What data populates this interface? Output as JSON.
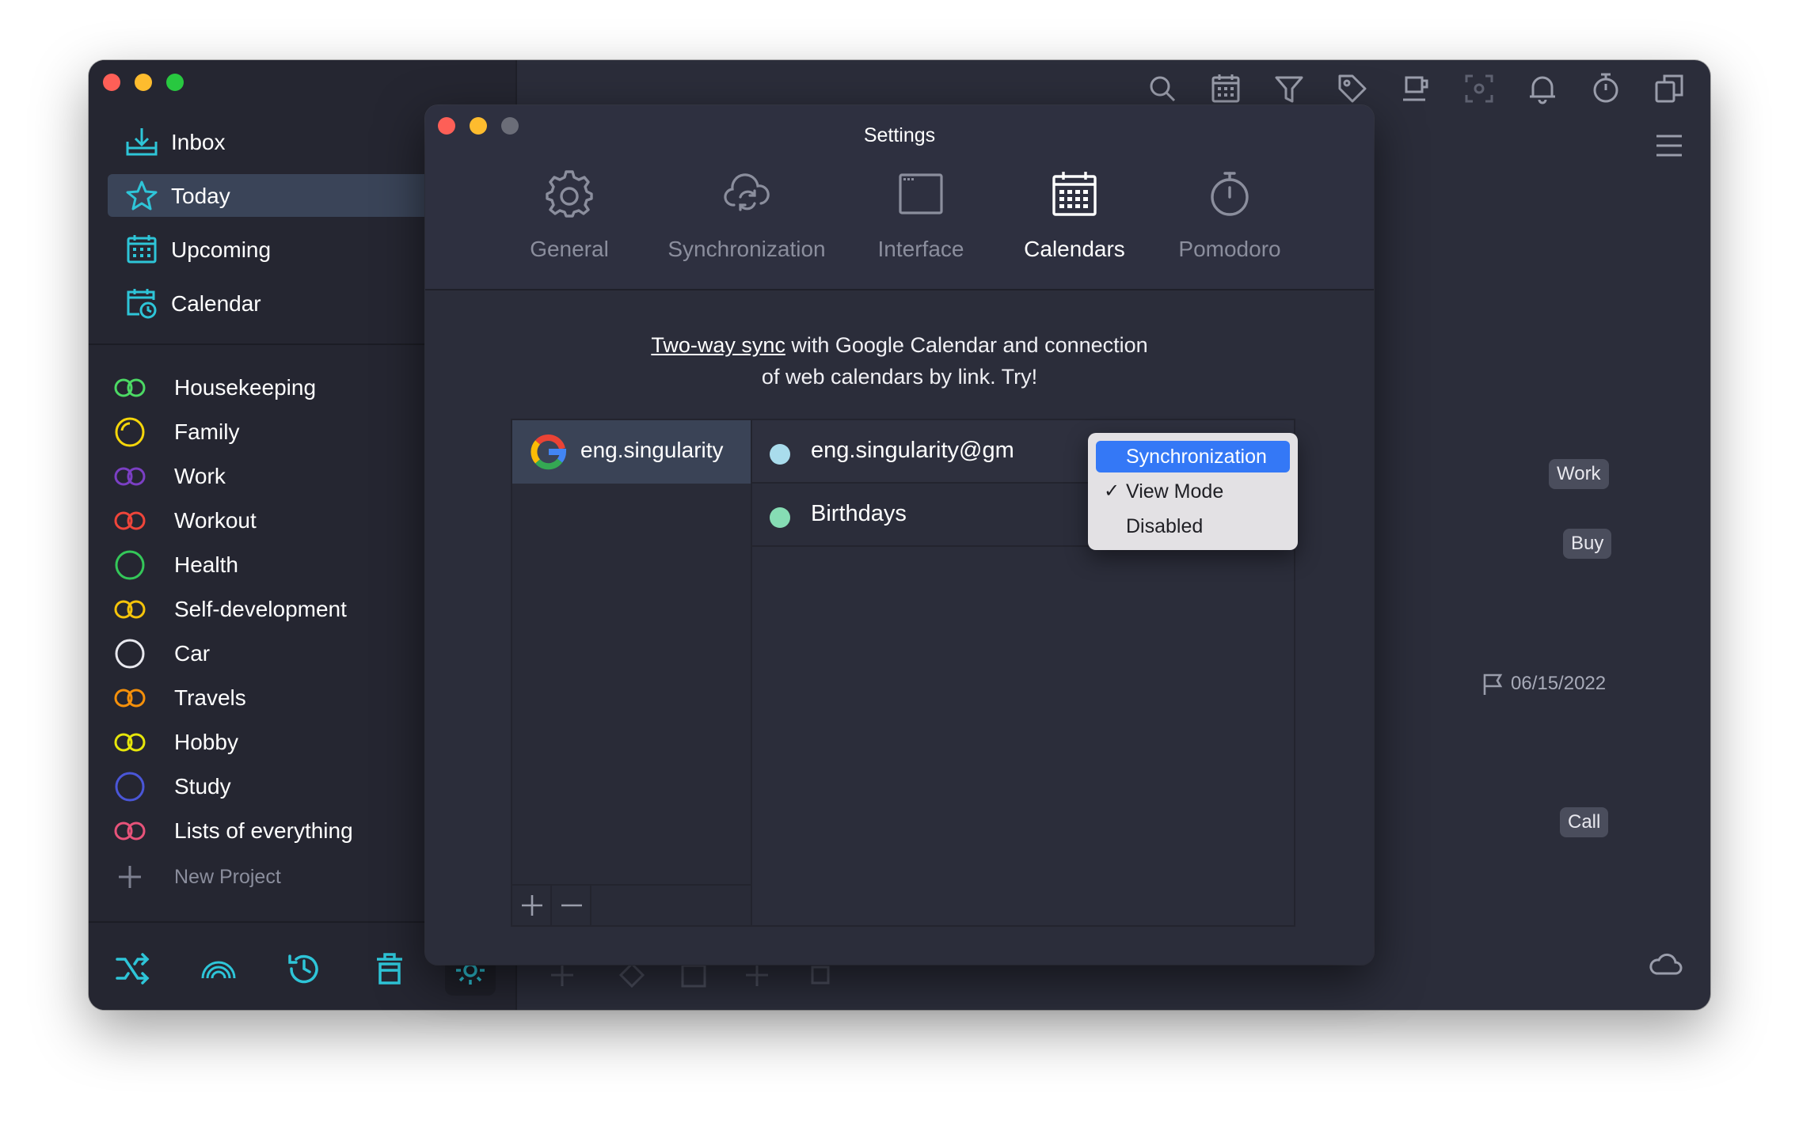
{
  "sidebar": {
    "nav": [
      {
        "label": "Inbox",
        "icon": "inbox-tray-icon"
      },
      {
        "label": "Today",
        "icon": "star-icon"
      },
      {
        "label": "Upcoming",
        "icon": "calendar-grid-icon"
      },
      {
        "label": "Calendar",
        "icon": "calendar-clock-icon"
      }
    ],
    "projects": [
      {
        "label": "Housekeeping",
        "color": "#4cd964"
      },
      {
        "label": "Family",
        "color": "#f5d60a"
      },
      {
        "label": "Work",
        "color": "#7b3fc4"
      },
      {
        "label": "Workout",
        "color": "#f0453a"
      },
      {
        "label": "Health",
        "color": "#34c759"
      },
      {
        "label": "Self-development",
        "color": "#f5c40a"
      },
      {
        "label": "Car",
        "color": "#e8e8ee"
      },
      {
        "label": "Travels",
        "color": "#f5900a"
      },
      {
        "label": "Hobby",
        "color": "#e6e60a"
      },
      {
        "label": "Study",
        "color": "#4a56d8"
      },
      {
        "label": "Lists of everything",
        "color": "#e8537a"
      }
    ],
    "new_project": "New Project"
  },
  "content": {
    "badges": {
      "work": "Work",
      "buy": "Buy",
      "call": "Call"
    },
    "due_date": "06/15/2022"
  },
  "settings": {
    "title": "Settings",
    "tabs": [
      {
        "label": "General",
        "icon": "gear-icon"
      },
      {
        "label": "Synchronization",
        "icon": "cloud-sync-icon"
      },
      {
        "label": "Interface",
        "icon": "window-icon"
      },
      {
        "label": "Calendars",
        "icon": "calendar-icon"
      },
      {
        "label": "Pomodoro",
        "icon": "timer-icon"
      }
    ],
    "active_tab": "Calendars",
    "promo": {
      "link": "Two-way sync",
      "text1": " with Google Calendar and connection",
      "text2": "of web calendars by link. Try!"
    },
    "account": {
      "name": "eng.singularity",
      "icon": "google-icon"
    },
    "calendars": [
      {
        "name": "eng.singularity@gm",
        "color": "#a9dcec"
      },
      {
        "name": "Birthdays",
        "color": "#86dcb4"
      }
    ],
    "dropdown": {
      "items": [
        "Synchronization",
        "View Mode",
        "Disabled"
      ],
      "highlighted": "Synchronization",
      "checked": "View Mode"
    }
  },
  "colors": {
    "accent": "#2ec5d8",
    "highlight": "#3478f6",
    "active_nav": "#3a4458"
  }
}
